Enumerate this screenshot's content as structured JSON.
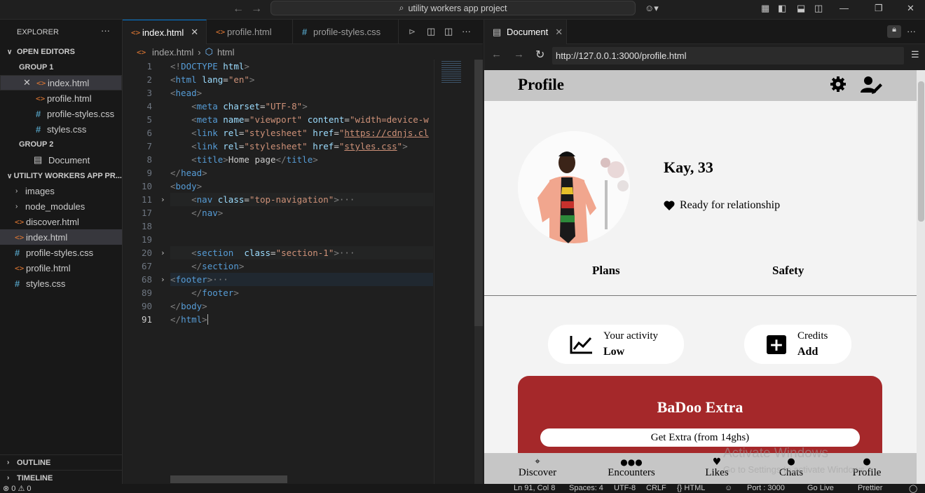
{
  "titlebar": {
    "search_text": "utility workers app project"
  },
  "sidebar": {
    "title": "EXPLORER",
    "open_editors": "OPEN EDITORS",
    "group1": "GROUP 1",
    "group1_files": [
      "index.html",
      "profile.html",
      "profile-styles.css",
      "styles.css"
    ],
    "group2": "GROUP 2",
    "group2_files": [
      "Document"
    ],
    "project": "UTILITY WORKERS APP PR...",
    "tree": [
      "images",
      "node_modules",
      "discover.html",
      "index.html",
      "profile-styles.css",
      "profile.html",
      "styles.css"
    ],
    "outline": "OUTLINE",
    "timeline": "TIMELINE"
  },
  "tabs": [
    "index.html",
    "profile.html",
    "profile-styles.css"
  ],
  "breadcrumb": {
    "file": "index.html",
    "symbol": "html"
  },
  "editor": {
    "line_numbers": [
      "1",
      "2",
      "3",
      "4",
      "5",
      "6",
      "7",
      "8",
      "9",
      "10",
      "11",
      "17",
      "18",
      "19",
      "20",
      "67",
      "68",
      "89",
      "90",
      "91"
    ]
  },
  "browser": {
    "tab_title": "Document",
    "url": "http://127.0.0.1:3000/profile.html",
    "page": {
      "header_title": "Profile",
      "name": "Kay, 33",
      "status": "Ready for relationship",
      "links": [
        "Plans",
        "Safety"
      ],
      "activity_label": "Your activity",
      "activity_value": "Low",
      "credits_label": "Credits",
      "credits_value": "Add",
      "promo_title": "BaDoo Extra",
      "promo_button": "Get Extra (from 14ghs)",
      "nav": [
        "Discover",
        "Encounters",
        "Likes",
        "Chats",
        "Profile"
      ],
      "promo_color": "#a5282a",
      "watermark_title": "Activate Windows",
      "watermark_sub": "Go to Settings to activate Windows."
    }
  },
  "statusbar": {
    "problems": "⊗ 0 ⚠ 0",
    "cursor": "Ln 91, Col 8",
    "spaces": "Spaces: 4",
    "encoding": "UTF-8",
    "eol": "CRLF",
    "language": "{} HTML",
    "port": "Port : 3000",
    "golive": "Go Live",
    "prettier": "Prettier"
  }
}
